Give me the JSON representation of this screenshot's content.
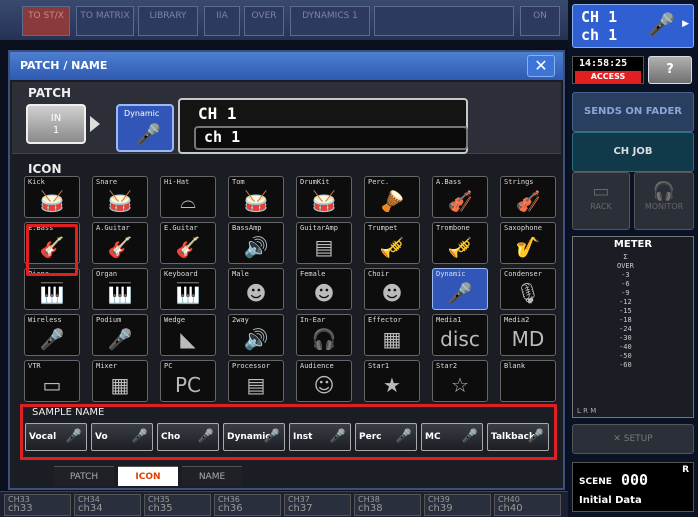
{
  "top_bar": {
    "tabs": [
      "TO ST/X",
      "TO MATRIX",
      "LIBRARY",
      "IIA",
      "OVER",
      "DYNAMICS 1",
      "",
      "ON"
    ]
  },
  "dialog": {
    "title": "PATCH / NAME",
    "close_glyph": "✕",
    "patch_label": "PATCH",
    "input_button": "IN\n1",
    "channel_icon_label": "Dynamic",
    "channel_name": "CH 1",
    "channel_name_value": "ch 1",
    "icon_section_label": "ICON",
    "icons": [
      {
        "label": "Kick",
        "glyph": "🥁"
      },
      {
        "label": "Snare",
        "glyph": "🥁"
      },
      {
        "label": "Hi-Hat",
        "glyph": "⌓"
      },
      {
        "label": "Tom",
        "glyph": "🥁"
      },
      {
        "label": "DrumKit",
        "glyph": "🥁"
      },
      {
        "label": "Perc.",
        "glyph": "🪘"
      },
      {
        "label": "A.Bass",
        "glyph": "🎻"
      },
      {
        "label": "Strings",
        "glyph": "🎻"
      },
      {
        "label": "E.Bass",
        "glyph": "🎸"
      },
      {
        "label": "A.Guitar",
        "glyph": "🎸"
      },
      {
        "label": "E.Guitar",
        "glyph": "🎸"
      },
      {
        "label": "BassAmp",
        "glyph": "🔊"
      },
      {
        "label": "GuitarAmp",
        "glyph": "▤"
      },
      {
        "label": "Trumpet",
        "glyph": "🎺"
      },
      {
        "label": "Trombone",
        "glyph": "🎺"
      },
      {
        "label": "Saxophone",
        "glyph": "🎷"
      },
      {
        "label": "Piano",
        "glyph": "🎹"
      },
      {
        "label": "Organ",
        "glyph": "🎹"
      },
      {
        "label": "Keyboard",
        "glyph": "🎹"
      },
      {
        "label": "Male",
        "glyph": "☻"
      },
      {
        "label": "Female",
        "glyph": "☻"
      },
      {
        "label": "Choir",
        "glyph": "☻"
      },
      {
        "label": "Dynamic",
        "glyph": "🎤"
      },
      {
        "label": "Condenser",
        "glyph": "🎙"
      },
      {
        "label": "Wireless",
        "glyph": "🎤"
      },
      {
        "label": "Podium",
        "glyph": "🎤"
      },
      {
        "label": "Wedge",
        "glyph": "◣"
      },
      {
        "label": "2way",
        "glyph": "🔊"
      },
      {
        "label": "In-Ear",
        "glyph": "🎧"
      },
      {
        "label": "Effector",
        "glyph": "▦"
      },
      {
        "label": "Media1",
        "glyph": "disc"
      },
      {
        "label": "Media2",
        "glyph": "MD"
      },
      {
        "label": "VTR",
        "glyph": "▭"
      },
      {
        "label": "Mixer",
        "glyph": "▦"
      },
      {
        "label": "PC",
        "glyph": "PC"
      },
      {
        "label": "Processor",
        "glyph": "▤"
      },
      {
        "label": "Audience",
        "glyph": "☺"
      },
      {
        "label": "Star1",
        "glyph": "★"
      },
      {
        "label": "Star2",
        "glyph": "☆"
      },
      {
        "label": "Blank",
        "glyph": ""
      }
    ],
    "sample_name_label": "SAMPLE NAME",
    "sample_names": [
      "Vocal",
      "Vo",
      "Cho",
      "Dynamic",
      "Inst",
      "Perc",
      "MC",
      "Talkback"
    ],
    "bottom_tabs": [
      "PATCH",
      "ICON",
      "NAME"
    ]
  },
  "bottom_strip": {
    "channels": [
      {
        "num": "CH33",
        "name": "ch33"
      },
      {
        "num": "CH34",
        "name": "ch34"
      },
      {
        "num": "CH35",
        "name": "ch35"
      },
      {
        "num": "CH36",
        "name": "ch36"
      },
      {
        "num": "CH37",
        "name": "ch37"
      },
      {
        "num": "CH38",
        "name": "ch38"
      },
      {
        "num": "CH39",
        "name": "ch39"
      },
      {
        "num": "CH40",
        "name": "ch40"
      }
    ]
  },
  "right_panel": {
    "channel_line1": "CH 1",
    "channel_line2": "ch 1",
    "time": "14:58:25",
    "access": "ACCESS",
    "help": "?",
    "sends_on_fader": "SENDS ON FADER",
    "ch_job": "CH JOB",
    "rack": "RACK",
    "monitor": "MONITOR",
    "meter_title": "METER",
    "meter_scale": [
      "Σ",
      "OVER",
      "-3",
      "-6",
      "-9",
      "-12",
      "-15",
      "-18",
      "-24",
      "-30",
      "-40",
      "-50",
      "-60"
    ],
    "meter_lrm": "L R M",
    "setup": "SETUP",
    "scene_label": "SCENE",
    "scene_number": "000",
    "scene_r": "R",
    "scene_name": "Initial Data"
  }
}
